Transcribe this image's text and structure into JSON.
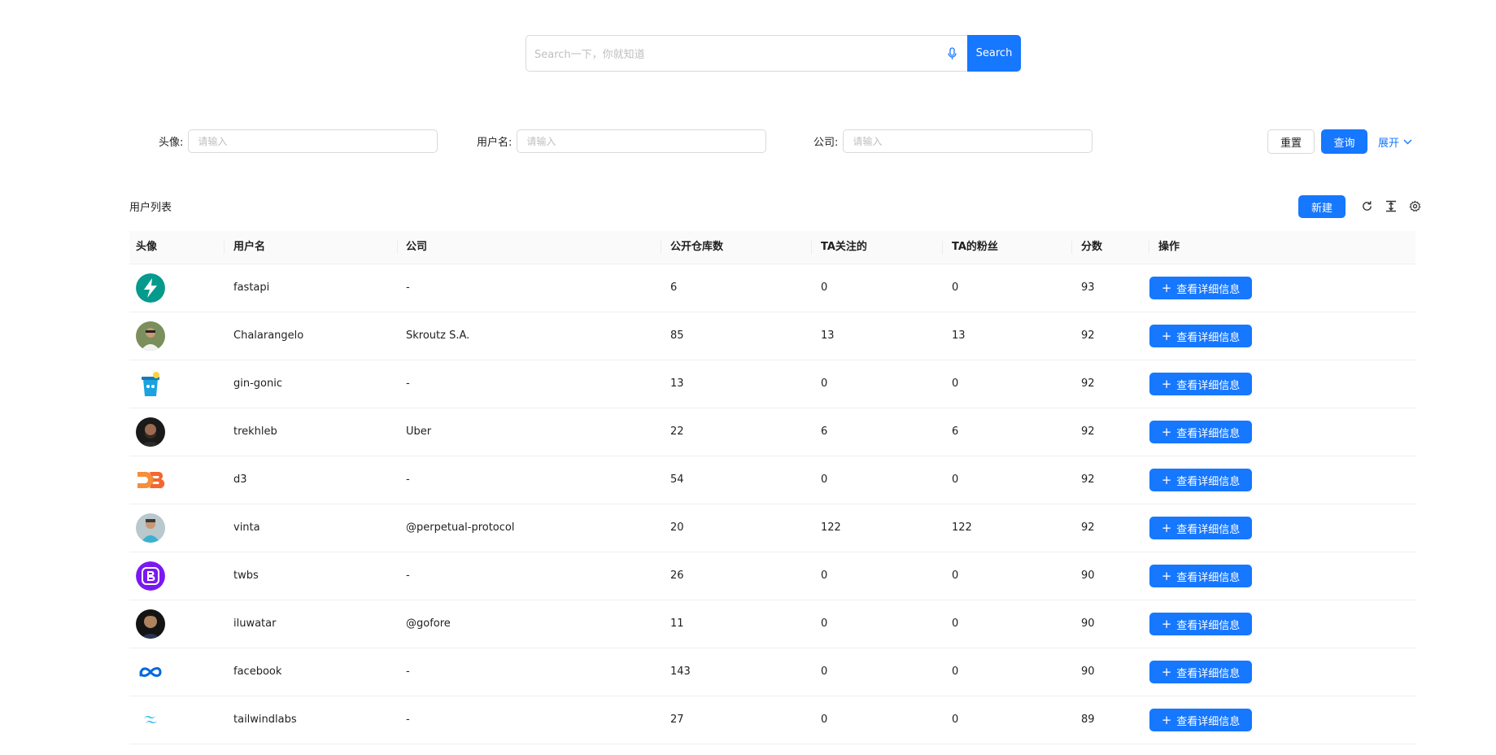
{
  "search": {
    "placeholder": "Search一下，你就知道",
    "button_label": "Search"
  },
  "filters": [
    {
      "label": "头像:",
      "placeholder": "请输入"
    },
    {
      "label": "用户名:",
      "placeholder": "请输入"
    },
    {
      "label": "公司:",
      "placeholder": "请输入"
    }
  ],
  "actions": {
    "reset_label": "重置",
    "query_label": "查询",
    "expand_label": "展开"
  },
  "list": {
    "title": "用户列表",
    "new_label": "新建",
    "columns": [
      "头像",
      "用户名",
      "公司",
      "公开仓库数",
      "TA关注的",
      "TA的粉丝",
      "分数",
      "操作"
    ],
    "detail_label": "查看详细信息",
    "rows": [
      {
        "avatar": "fastapi-logo",
        "username": "fastapi",
        "company": "-",
        "repos": "6",
        "following": "0",
        "followers": "0",
        "score": "93"
      },
      {
        "avatar": "user-photo",
        "username": "Chalarangelo",
        "company": "Skroutz S.A.",
        "repos": "85",
        "following": "13",
        "followers": "13",
        "score": "92"
      },
      {
        "avatar": "gin-logo",
        "username": "gin-gonic",
        "company": "-",
        "repos": "13",
        "following": "0",
        "followers": "0",
        "score": "92"
      },
      {
        "avatar": "user-photo",
        "username": "trekhleb",
        "company": "Uber",
        "repos": "22",
        "following": "6",
        "followers": "6",
        "score": "92"
      },
      {
        "avatar": "d3-logo",
        "username": "d3",
        "company": "-",
        "repos": "54",
        "following": "0",
        "followers": "0",
        "score": "92"
      },
      {
        "avatar": "user-photo",
        "username": "vinta",
        "company": "@perpetual-protocol",
        "repos": "20",
        "following": "122",
        "followers": "122",
        "score": "92"
      },
      {
        "avatar": "bootstrap-logo",
        "username": "twbs",
        "company": "-",
        "repos": "26",
        "following": "0",
        "followers": "0",
        "score": "90"
      },
      {
        "avatar": "user-photo",
        "username": "iluwatar",
        "company": "@gofore",
        "repos": "11",
        "following": "0",
        "followers": "0",
        "score": "90"
      },
      {
        "avatar": "meta-logo",
        "username": "facebook",
        "company": "-",
        "repos": "143",
        "following": "0",
        "followers": "0",
        "score": "90"
      },
      {
        "avatar": "tailwind-logo",
        "username": "tailwindlabs",
        "company": "-",
        "repos": "27",
        "following": "0",
        "followers": "0",
        "score": "89"
      }
    ]
  },
  "colors": {
    "primary": "#1677ff",
    "border": "#d9d9d9",
    "header_bg": "#fafafa"
  }
}
